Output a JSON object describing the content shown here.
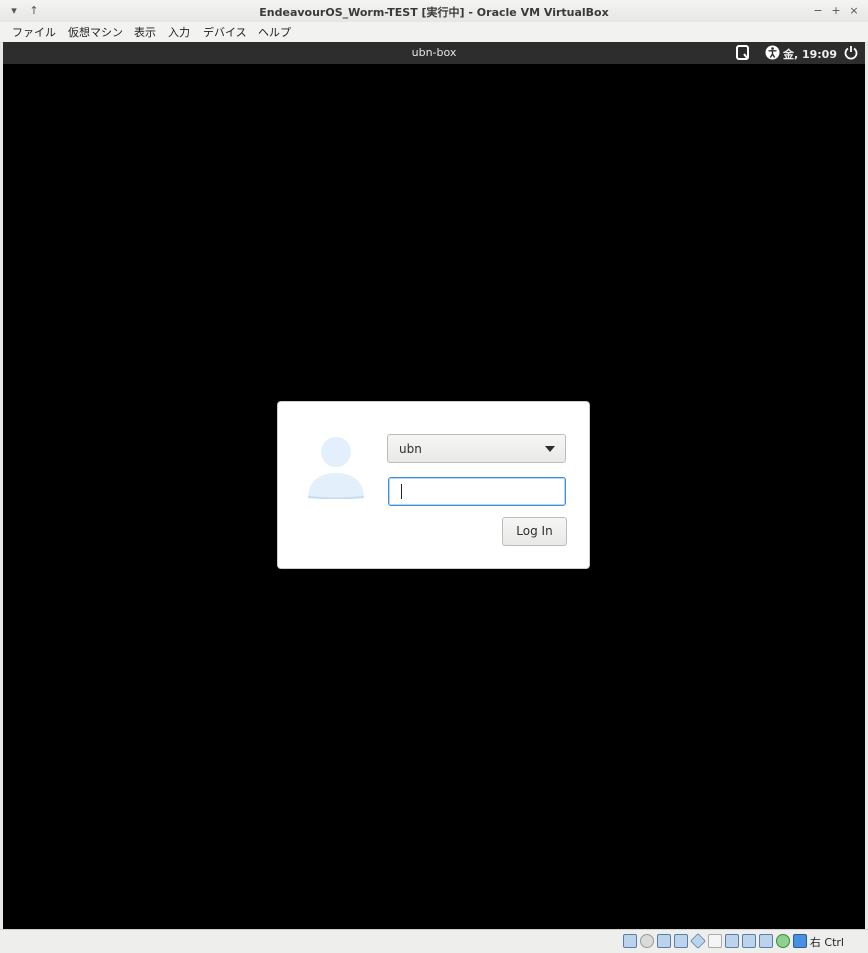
{
  "window": {
    "title": "EndeavourOS_Worm-TEST [実行中] - Oracle VM VirtualBox",
    "controls": {
      "menu": "▾",
      "pin": "↑",
      "minimize": "−",
      "maximize": "+",
      "close": "×"
    }
  },
  "menubar": {
    "items": [
      "ファイル",
      "仮想マシン",
      "表示",
      "入力",
      "デバイス",
      "ヘルプ"
    ]
  },
  "guest_panel": {
    "hostname": "ubn-box",
    "clock": "金, 19:09",
    "icons": [
      "keyboard-layout-icon",
      "accessibility-icon",
      "power-icon"
    ]
  },
  "login": {
    "selected_user": "ubn",
    "password_value": "",
    "login_button": "Log In"
  },
  "statusbar": {
    "host_key": "右 Ctrl",
    "icons": [
      "hard-disk-icon",
      "optical-drive-icon",
      "audio-icon",
      "network-icon",
      "usb-icon",
      "shared-folders-icon",
      "display-icon",
      "video-capture-icon",
      "recording-icon",
      "cpu-icon",
      "mouse-integration-icon",
      "keyboard-capture-icon"
    ]
  },
  "colors": {
    "guest_bg": "#000000",
    "panel_bg": "#2d2d2d",
    "focus_blue": "#3d8ee0"
  }
}
